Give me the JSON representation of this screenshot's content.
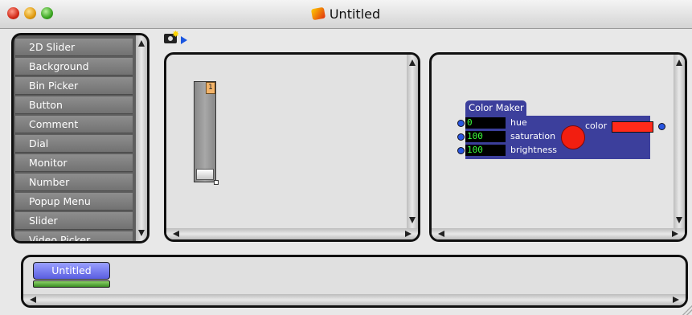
{
  "window": {
    "title": "Untitled"
  },
  "palette": {
    "items": [
      "2D Slider",
      "Background",
      "Bin Picker",
      "Button",
      "Comment",
      "Dial",
      "Monitor",
      "Number",
      "Popup Menu",
      "Slider",
      "Video Picker"
    ]
  },
  "canvas_slider": {
    "badge": "1",
    "value": 0
  },
  "color_maker": {
    "title": "Color Maker",
    "inputs": [
      {
        "value": "0",
        "label": "hue"
      },
      {
        "value": "100",
        "label": "saturation"
      },
      {
        "value": "100",
        "label": "brightness"
      }
    ],
    "output_label": "color",
    "swatch_color": "#f21e10"
  },
  "bottom": {
    "tab_label": "Untitled"
  }
}
